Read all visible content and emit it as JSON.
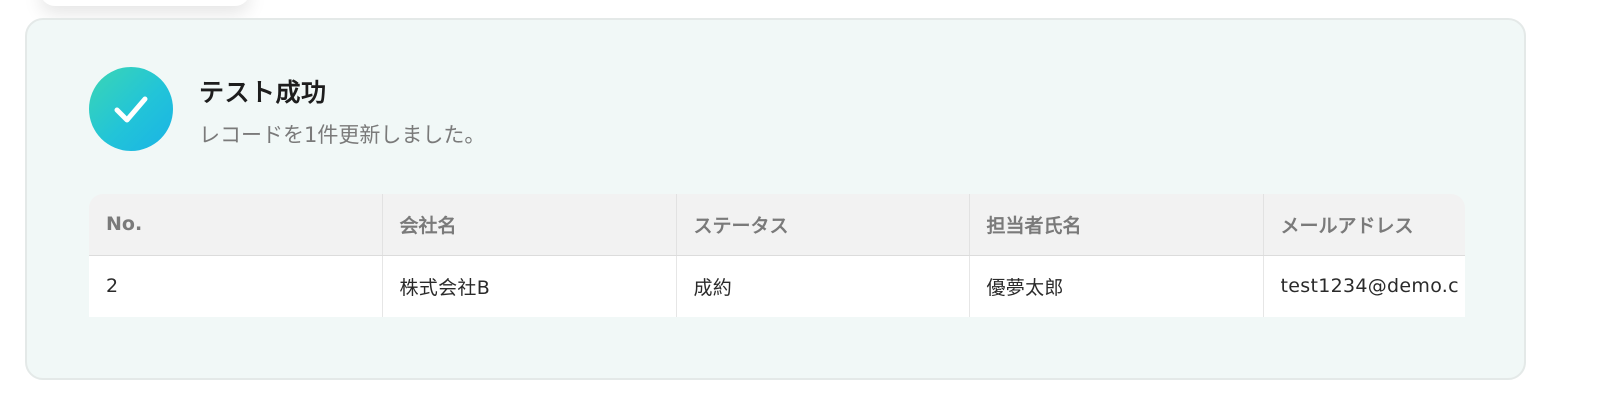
{
  "result": {
    "title": "テスト成功",
    "message": "レコードを1件更新しました。",
    "status_icon": "check-icon",
    "accent_colors": [
      "#3bd6b4",
      "#1ab3e6"
    ],
    "card_background": "#f1f8f7"
  },
  "table": {
    "columns": [
      "No.",
      "会社名",
      "ステータス",
      "担当者氏名",
      "メールアドレス"
    ],
    "rows": [
      [
        "2",
        "株式会社B",
        "成約",
        "優夢太郎",
        "test1234@demo.c"
      ]
    ]
  }
}
